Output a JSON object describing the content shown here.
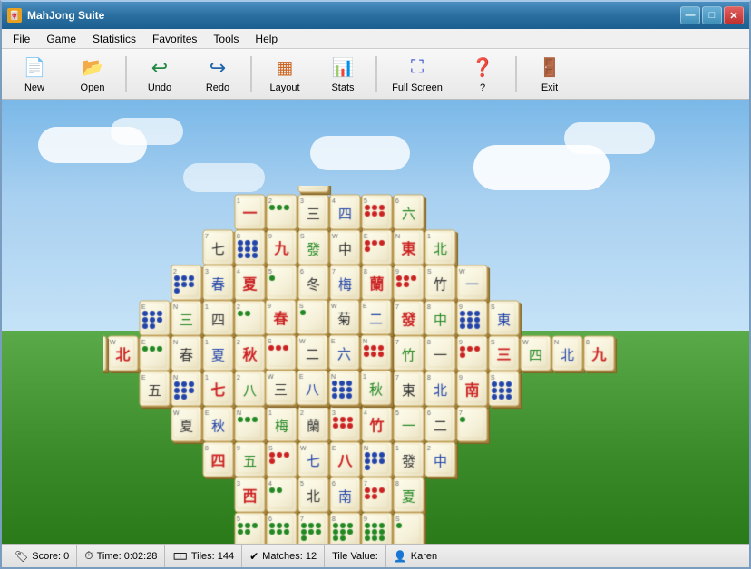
{
  "window": {
    "title": "MahJong Suite",
    "icon": "🀄"
  },
  "titlebar": {
    "title": "MahJong Suite",
    "buttons": {
      "minimize": "—",
      "maximize": "□",
      "close": "✕"
    }
  },
  "menubar": {
    "items": [
      {
        "label": "File",
        "id": "file"
      },
      {
        "label": "Game",
        "id": "game"
      },
      {
        "label": "Statistics",
        "id": "statistics"
      },
      {
        "label": "Favorites",
        "id": "favorites"
      },
      {
        "label": "Tools",
        "id": "tools"
      },
      {
        "label": "Help",
        "id": "help"
      }
    ]
  },
  "toolbar": {
    "buttons": [
      {
        "id": "new",
        "label": "New",
        "icon": "📄"
      },
      {
        "id": "open",
        "label": "Open",
        "icon": "📂"
      },
      {
        "id": "undo",
        "label": "Undo",
        "icon": "↩"
      },
      {
        "id": "redo",
        "label": "Redo",
        "icon": "↪"
      },
      {
        "id": "layout",
        "label": "Layout",
        "icon": "▦"
      },
      {
        "id": "stats",
        "label": "Stats",
        "icon": "📊"
      },
      {
        "id": "fullscreen",
        "label": "Full Screen",
        "icon": "⛶"
      },
      {
        "id": "help",
        "label": "?",
        "icon": "❓"
      },
      {
        "id": "exit",
        "label": "Exit",
        "icon": "🚪"
      }
    ]
  },
  "statusbar": {
    "score": "Score: 0",
    "time": "Time: 0:02:28",
    "tiles": "Tiles: 144",
    "matches": "Matches: 12",
    "tile_value": "Tile Value:",
    "player": "Karen"
  }
}
